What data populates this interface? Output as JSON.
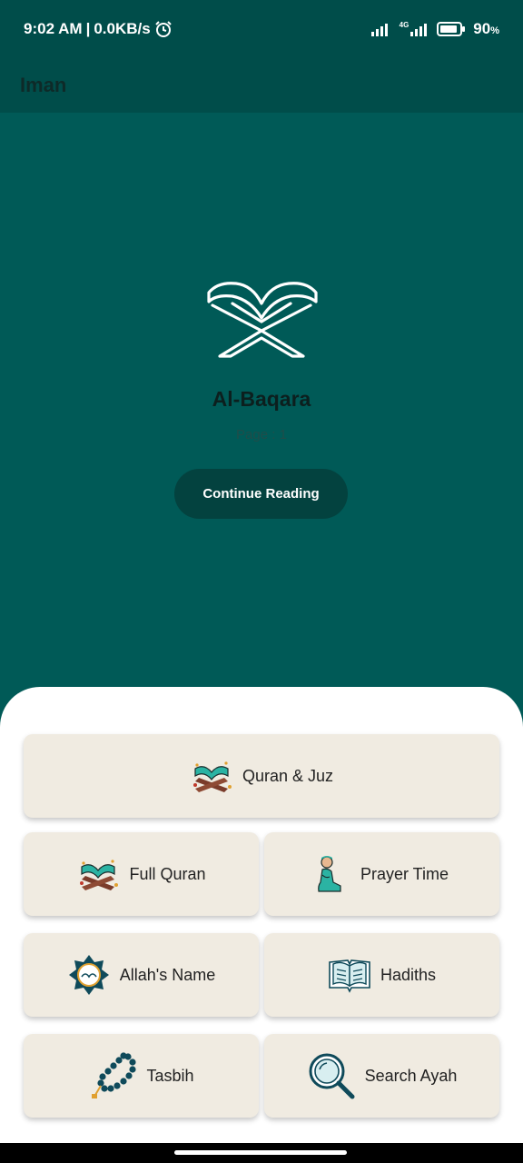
{
  "status": {
    "time": "9:02 AM",
    "separator": "|",
    "speed": "0.0KB/s",
    "network": "4G",
    "battery": "90",
    "battery_unit": "%",
    "battery_level": 0.9,
    "icons": [
      "alarm-icon",
      "signal-icon",
      "battery-icon"
    ]
  },
  "app": {
    "title": "Iman"
  },
  "hero": {
    "icon": "quran-stand-icon",
    "surah": "Al-Baqara",
    "page_label": "Page : 1",
    "button_label": "Continue Reading"
  },
  "menu": {
    "quran_juz": "Quran & Juz",
    "full_quran": "Full Quran",
    "prayer_time": "Prayer Time",
    "allahs_name": "Allah's Name",
    "hadiths": "Hadiths",
    "tasbih": "Tasbih",
    "search_ayah": "Search Ayah"
  },
  "colors": {
    "primary": "#005a57",
    "app_bar": "#004d4a",
    "button": "#03423f",
    "card": "#f0ebe1",
    "icon_accent": "#2bb3a3",
    "icon_wood": "#7a3b2a"
  }
}
